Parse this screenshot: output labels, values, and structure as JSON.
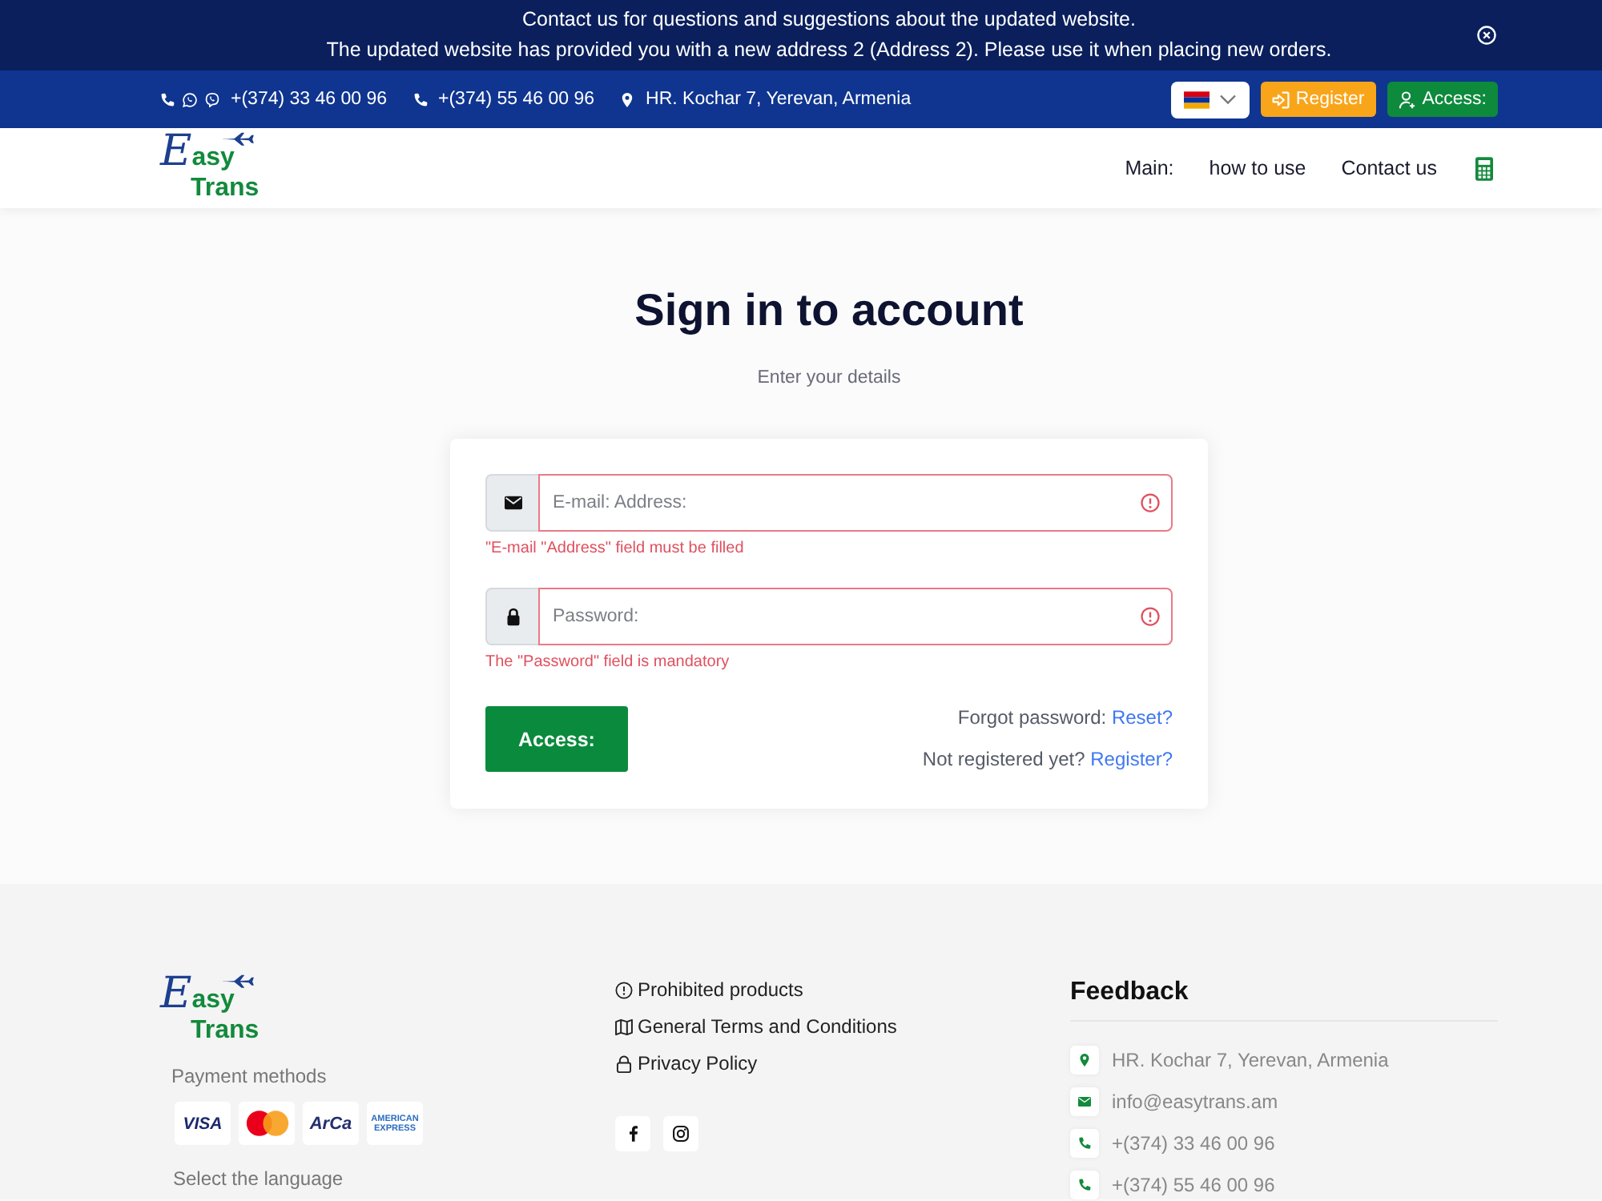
{
  "announcement": {
    "lines": [
      "Contact us for questions and suggestions about the updated website.",
      "The updated website has provided you with a new address 2 (Address 2). Please use it when placing new orders."
    ]
  },
  "contact_bar": {
    "phones": [
      {
        "kind": "messengers",
        "number": "+(374) 33 46 00 96"
      },
      {
        "kind": "phone",
        "number": "+(374) 55 46 00 96"
      }
    ],
    "address": "HR. Kochar 7, Yerevan, Armenia",
    "register_button": "Register",
    "access_button": "Access:"
  },
  "header": {
    "logo": {
      "line1": "Easy",
      "line2": "Trans"
    },
    "nav": [
      "Main:",
      "how to use",
      "Contact us"
    ]
  },
  "main": {
    "title": "Sign in to account",
    "subtitle": "Enter your details"
  },
  "form": {
    "fields": [
      {
        "kind": "email",
        "placeholder": "E-mail: Address:",
        "invalid": true,
        "error": "\"E-mail \"Address\" field must be filled"
      },
      {
        "kind": "password",
        "placeholder": "Password:",
        "invalid": true,
        "error": "The \"Password\" field is mandatory"
      }
    ],
    "submit": "Access:",
    "links": [
      {
        "text": "Forgot password:",
        "link": "Reset?"
      },
      {
        "text": "Not registered yet?",
        "link": "Register?"
      }
    ]
  },
  "footer": {
    "logo": {
      "line1": "Easy",
      "line2": "Trans"
    },
    "payment_title": "Payment methods",
    "payment_methods": [
      {
        "kind": "visa",
        "label": "VISA"
      },
      {
        "kind": "mastercard"
      },
      {
        "kind": "arca",
        "label": "ArCa"
      },
      {
        "kind": "amex",
        "label": "AMERICAN EXPRESS"
      }
    ],
    "language_title": "Select the language",
    "links": [
      {
        "kind": "prohibited",
        "label": "Prohibited products"
      },
      {
        "kind": "terms",
        "label": "General Terms and Conditions"
      },
      {
        "kind": "privacy",
        "label": "Privacy Policy"
      }
    ],
    "social": [
      {
        "kind": "facebook"
      },
      {
        "kind": "instagram"
      }
    ],
    "feedback": {
      "title": "Feedback",
      "contacts": [
        {
          "kind": "address",
          "text": "HR. Kochar 7, Yerevan, Armenia"
        },
        {
          "kind": "email",
          "text": "info@easytrans.am"
        },
        {
          "kind": "phone",
          "text": "+(374) 33 46 00 96"
        },
        {
          "kind": "phone",
          "text": "+(374) 55 46 00 96"
        }
      ]
    }
  }
}
